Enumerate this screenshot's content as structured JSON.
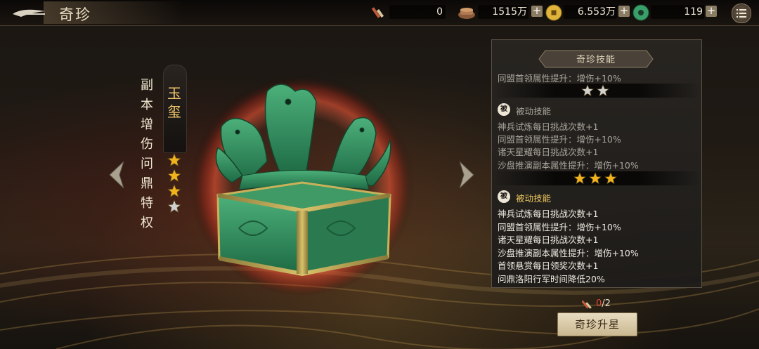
{
  "header": {
    "title": "奇珍",
    "resources": [
      {
        "icon": "scroll-icon",
        "value": "0"
      },
      {
        "icon": "ingot-icon",
        "value": "1515万"
      },
      {
        "icon": "gold-coin-icon",
        "value": "6.553万"
      },
      {
        "icon": "jade-coin-icon",
        "value": "119"
      }
    ],
    "plus": "+"
  },
  "artifact": {
    "name_chars": [
      "玉",
      "玺"
    ],
    "privilege_chars": [
      "副",
      "本",
      "增",
      "伤",
      "问",
      "鼎",
      "特",
      "权"
    ],
    "stars_total": 4,
    "stars_filled": 3
  },
  "skills": {
    "title": "奇珍技能",
    "base_line": "同盟首领属性提升：增伤+10%",
    "tier2": {
      "stars": 2,
      "badge": "被",
      "heading": "被动技能",
      "lines": [
        "神兵试炼每日挑战次数+1",
        "同盟首领属性提升：增伤+10%",
        "诸天星耀每日挑战次数+1",
        "沙盘推演副本属性提升：增伤+10%"
      ]
    },
    "tier3": {
      "stars": 3,
      "badge": "被",
      "heading": "被动技能",
      "lines": [
        "神兵试炼每日挑战次数+1",
        "同盟首领属性提升：增伤+10%",
        "诸天星耀每日挑战次数+1",
        "沙盘推演副本属性提升：增伤+10%",
        "首领悬赏每日领奖次数+1",
        "问鼎洛阳行军时间降低20%"
      ]
    }
  },
  "upgrade": {
    "cost_have": "0",
    "cost_sep": "/",
    "cost_need": "2",
    "button_label": "奇珍升星"
  },
  "colors": {
    "gold": "#f1c76a",
    "star_gold": "#f2b21c",
    "star_grey": "#d0d0d0",
    "jade": "#2f8f5a",
    "cost_red": "#e04a3a"
  }
}
